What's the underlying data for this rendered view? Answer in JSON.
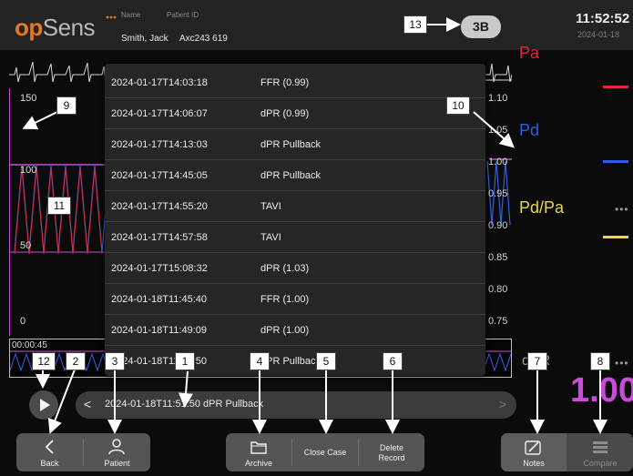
{
  "header": {
    "logo_op": "op",
    "logo_sens": "Sens",
    "name_label": "Name",
    "patient_id_label": "Patient ID",
    "name_value": "Smith, Jack",
    "patient_id_value": "Axc243 619",
    "room_badge": "3B",
    "clock": "11:52:52",
    "date": "2024-01-18"
  },
  "plot": {
    "pressure_ticks": [
      "150",
      "100",
      "50",
      "0"
    ],
    "ratio_ticks": [
      "1.10",
      "1.05",
      "1.00",
      "0.95",
      "0.90",
      "0.85",
      "0.80",
      "0.75"
    ],
    "strip_time": "00:00:45"
  },
  "signals": {
    "pa_label": "Pa",
    "pd_label": "Pd",
    "pdpa_label": "Pd/Pa",
    "pa_color": "#e0263a",
    "pd_color": "#2a5ee8",
    "pdpa_color": "#e6d64a",
    "pd_pa_placeholder": "•••",
    "ratio_label": "dPR",
    "ratio_value": "1.00",
    "ratio_color": "#c94bd8"
  },
  "records": [
    {
      "time": "2024-01-17T14:03:18",
      "type": "FFR (0.99)"
    },
    {
      "time": "2024-01-17T14:06:07",
      "type": "dPR (0.99)"
    },
    {
      "time": "2024-01-17T14:13:03",
      "type": "dPR Pullback"
    },
    {
      "time": "2024-01-17T14:45:05",
      "type": "dPR Pullback"
    },
    {
      "time": "2024-01-17T14:55:20",
      "type": "TAVI"
    },
    {
      "time": "2024-01-17T14:57:58",
      "type": "TAVI"
    },
    {
      "time": "2024-01-17T15:08:32",
      "type": "dPR (1.03)"
    },
    {
      "time": "2024-01-18T11:45:40",
      "type": "FFR (1.00)"
    },
    {
      "time": "2024-01-18T11:49:09",
      "type": "dPR (1.00)"
    },
    {
      "time": "2024-01-18T11:51:50",
      "type": "dPR Pullback"
    }
  ],
  "selector": {
    "prev": "<",
    "selected": "2024-01-18T11:51:50   dPR Pullback",
    "next": ">"
  },
  "buttons": {
    "back": "Back",
    "patient": "Patient",
    "archive": "Archive",
    "close_case": "Close Case",
    "delete_record": "Delete Record",
    "notes": "Notes",
    "compare": "Compare"
  },
  "callouts": [
    "1",
    "2",
    "3",
    "4",
    "5",
    "6",
    "7",
    "8",
    "9",
    "10",
    "11",
    "12",
    "13"
  ]
}
